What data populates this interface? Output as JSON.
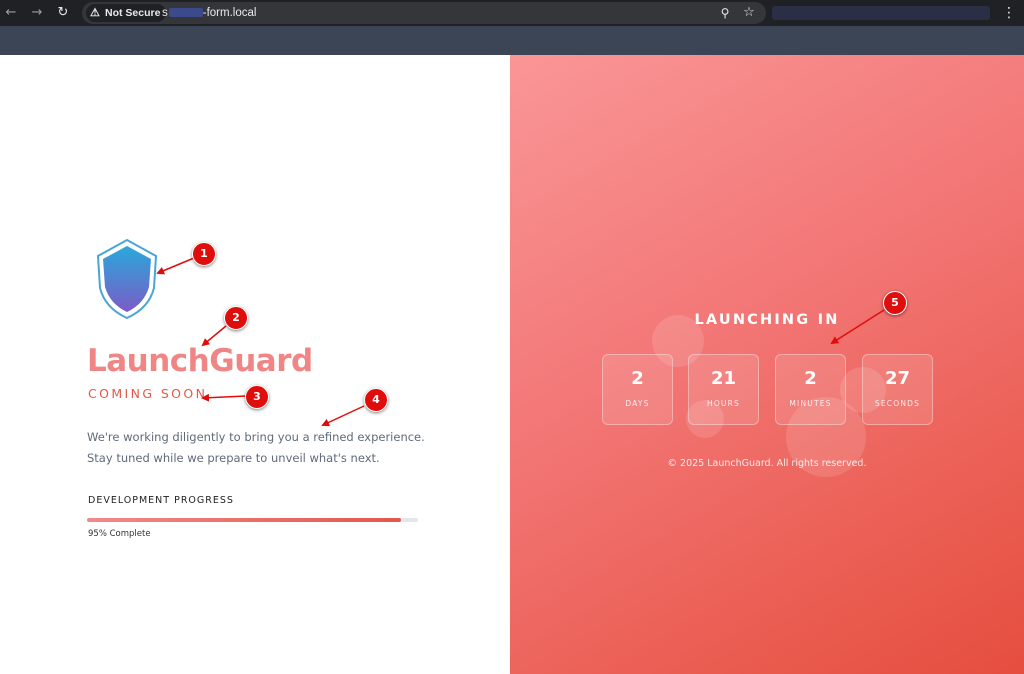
{
  "browser": {
    "security_label": "Not Secure",
    "url_prefix": "s",
    "url_suffix": "-form.local"
  },
  "brand": {
    "name": "LaunchGuard",
    "tagline": "COMING SOON",
    "description_lines": [
      "We're working diligently to bring you a refined experience.",
      "Stay tuned while we prepare to unveil what's next."
    ]
  },
  "progress": {
    "label": "DEVELOPMENT PROGRESS",
    "value_percent": 95,
    "text": "95% Complete"
  },
  "countdown": {
    "title": "LAUNCHING IN",
    "units": [
      {
        "value": "2",
        "label": "DAYS"
      },
      {
        "value": "21",
        "label": "HOURS"
      },
      {
        "value": "2",
        "label": "MINUTES"
      },
      {
        "value": "27",
        "label": "SECONDS"
      }
    ]
  },
  "footer": "© 2025 LaunchGuard. All rights reserved.",
  "annotations": [
    "1",
    "2",
    "3",
    "4",
    "5"
  ],
  "colors": {
    "brand_pink": "#f08585",
    "tagline_red": "#e25a4e",
    "annotation_red": "#e00d0d",
    "panel_start": "#fa9697",
    "panel_end": "#e54e3f"
  },
  "icons": [
    "back-arrow-icon",
    "forward-arrow-icon",
    "reload-icon",
    "warning-icon",
    "zoom-icon",
    "star-icon",
    "menu-icon",
    "shield-icon"
  ]
}
